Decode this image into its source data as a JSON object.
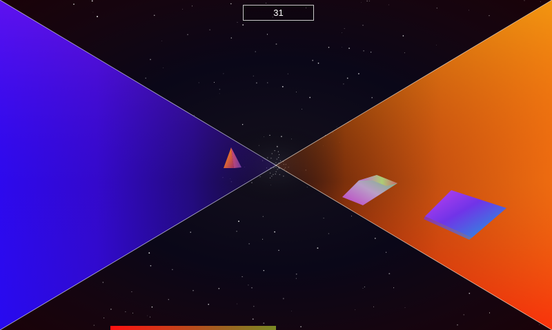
{
  "hud": {
    "score": "31",
    "energy_level": 0.5,
    "energy_colors": [
      "#ff1010",
      "#7a8a24"
    ]
  },
  "scene": {
    "left_wall_colors": [
      "#7a18f5",
      "#2a08d8",
      "#150a40"
    ],
    "right_wall_colors": [
      "#f5a010",
      "#e85a10",
      "#e01808"
    ],
    "background_color": "#0a0718",
    "star_color": "#ffffff",
    "objects": [
      {
        "name": "pyramid",
        "colors": [
          "#e86a30",
          "#c23a70",
          "#7a3a9a"
        ]
      },
      {
        "name": "tile-near",
        "colors": [
          "#b048f0",
          "#6a30e0",
          "#3a8ae0",
          "#5ad060"
        ]
      },
      {
        "name": "tile-far",
        "colors": [
          "#c040e0",
          "#b0b0e0",
          "#60d080"
        ]
      }
    ]
  }
}
